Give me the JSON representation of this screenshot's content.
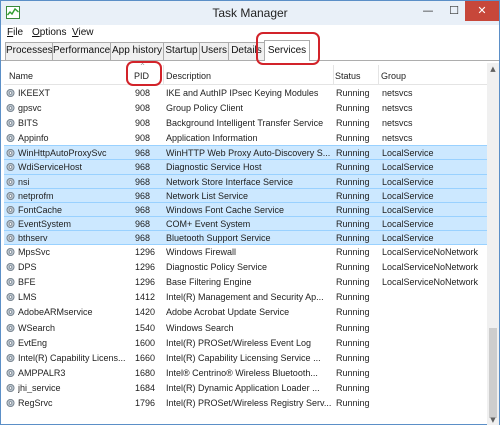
{
  "window": {
    "title": "Task Manager",
    "minimize_glyph": "—",
    "maximize_glyph": "☐",
    "close_glyph": "✕"
  },
  "menu": [
    "File",
    "Options",
    "View"
  ],
  "tabs": [
    {
      "label": "Processes"
    },
    {
      "label": "Performance"
    },
    {
      "label": "App history"
    },
    {
      "label": "Startup"
    },
    {
      "label": "Users"
    },
    {
      "label": "Details"
    },
    {
      "label": "Services",
      "active": true
    }
  ],
  "columns": {
    "name": "Name",
    "pid": "PID",
    "description": "Description",
    "status": "Status",
    "group": "Group",
    "sort_indicator": "^"
  },
  "colors": {
    "selected_row": "#cce8ff",
    "annotation": "#d2232a",
    "close_button": "#c7473a"
  },
  "services": [
    {
      "name": "IKEEXT",
      "pid": "908",
      "description": "IKE and AuthIP IPsec Keying Modules",
      "status": "Running",
      "group": "netsvcs",
      "selected": false
    },
    {
      "name": "gpsvc",
      "pid": "908",
      "description": "Group Policy Client",
      "status": "Running",
      "group": "netsvcs",
      "selected": false
    },
    {
      "name": "BITS",
      "pid": "908",
      "description": "Background Intelligent Transfer Service",
      "status": "Running",
      "group": "netsvcs",
      "selected": false
    },
    {
      "name": "Appinfo",
      "pid": "908",
      "description": "Application Information",
      "status": "Running",
      "group": "netsvcs",
      "selected": false
    },
    {
      "name": "WinHttpAutoProxySvc",
      "pid": "968",
      "description": "WinHTTP Web Proxy Auto-Discovery S...",
      "status": "Running",
      "group": "LocalService",
      "selected": true
    },
    {
      "name": "WdiServiceHost",
      "pid": "968",
      "description": "Diagnostic Service Host",
      "status": "Running",
      "group": "LocalService",
      "selected": true
    },
    {
      "name": "nsi",
      "pid": "968",
      "description": "Network Store Interface Service",
      "status": "Running",
      "group": "LocalService",
      "selected": true
    },
    {
      "name": "netprofm",
      "pid": "968",
      "description": "Network List Service",
      "status": "Running",
      "group": "LocalService",
      "selected": true
    },
    {
      "name": "FontCache",
      "pid": "968",
      "description": "Windows Font Cache Service",
      "status": "Running",
      "group": "LocalService",
      "selected": true
    },
    {
      "name": "EventSystem",
      "pid": "968",
      "description": "COM+ Event System",
      "status": "Running",
      "group": "LocalService",
      "selected": true
    },
    {
      "name": "bthserv",
      "pid": "968",
      "description": "Bluetooth Support Service",
      "status": "Running",
      "group": "LocalService",
      "selected": true
    },
    {
      "name": "MpsSvc",
      "pid": "1296",
      "description": "Windows Firewall",
      "status": "Running",
      "group": "LocalServiceNoNetwork",
      "selected": false
    },
    {
      "name": "DPS",
      "pid": "1296",
      "description": "Diagnostic Policy Service",
      "status": "Running",
      "group": "LocalServiceNoNetwork",
      "selected": false
    },
    {
      "name": "BFE",
      "pid": "1296",
      "description": "Base Filtering Engine",
      "status": "Running",
      "group": "LocalServiceNoNetwork",
      "selected": false
    },
    {
      "name": "LMS",
      "pid": "1412",
      "description": "Intel(R) Management and Security Ap...",
      "status": "Running",
      "group": "",
      "selected": false
    },
    {
      "name": "AdobeARMservice",
      "pid": "1420",
      "description": "Adobe Acrobat Update Service",
      "status": "Running",
      "group": "",
      "selected": false
    },
    {
      "name": "WSearch",
      "pid": "1540",
      "description": "Windows Search",
      "status": "Running",
      "group": "",
      "selected": false
    },
    {
      "name": "EvtEng",
      "pid": "1600",
      "description": "Intel(R) PROSet/Wireless Event Log",
      "status": "Running",
      "group": "",
      "selected": false
    },
    {
      "name": "Intel(R) Capability Licens...",
      "pid": "1660",
      "description": "Intel(R) Capability Licensing Service ...",
      "status": "Running",
      "group": "",
      "selected": false
    },
    {
      "name": "AMPPALR3",
      "pid": "1680",
      "description": "Intel® Centrino® Wireless Bluetooth...",
      "status": "Running",
      "group": "",
      "selected": false
    },
    {
      "name": "jhi_service",
      "pid": "1684",
      "description": "Intel(R) Dynamic Application Loader ...",
      "status": "Running",
      "group": "",
      "selected": false
    },
    {
      "name": "RegSrvc",
      "pid": "1796",
      "description": "Intel(R) PROSet/Wireless Registry Serv...",
      "status": "Running",
      "group": "",
      "selected": false
    }
  ]
}
